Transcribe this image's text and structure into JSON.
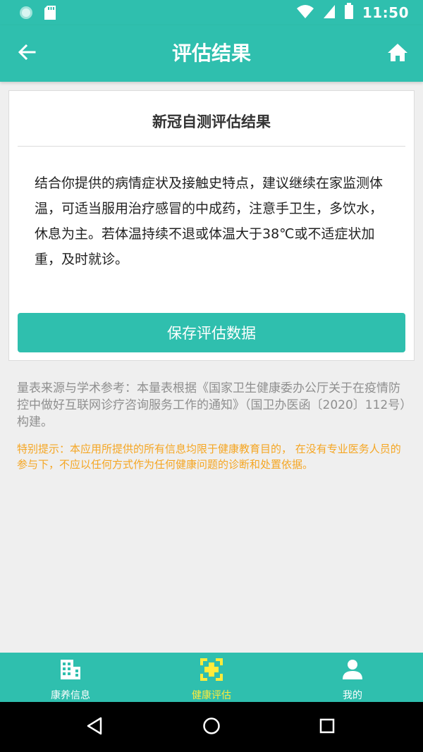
{
  "status_bar": {
    "time": "11:50"
  },
  "app_bar": {
    "title": "评估结果"
  },
  "card": {
    "title": "新冠自测评估结果",
    "body": "结合你提供的病情症状及接触史特点，建议继续在家监测体温，可适当服用治疗感冒的中成药，注意手卫生，多饮水，休息为主。若体温持续不退或体温大于38℃或不适症状加重，及时就诊。",
    "save_label": "保存评估数据"
  },
  "notes": {
    "source": "量表来源与学术参考：本量表根据《国家卫生健康委办公厅关于在疫情防控中做好互联网诊疗咨询服务工作的通知》（国卫办医函〔2020〕112号）构建。",
    "warning": "特别提示：本应用所提供的所有信息均限于健康教育目的， 在没有专业医务人员的参与下，不应以任何方式作为任何健康问题的诊断和处置依据。"
  },
  "bottom_nav": {
    "items": [
      {
        "label": "康养信息",
        "icon": "building-icon",
        "active": false
      },
      {
        "label": "健康评估",
        "icon": "medical-cross-icon",
        "active": true
      },
      {
        "label": "我的",
        "icon": "person-icon",
        "active": false
      }
    ]
  },
  "colors": {
    "primary": "#2fbfae",
    "active_nav": "#ffeb3b",
    "warning_text": "#f5a623",
    "muted_text": "#8f8f8f"
  },
  "icons": {
    "status_left": [
      "app-notification-icon",
      "sd-card-icon"
    ],
    "status_right": [
      "wifi-icon",
      "signal-icon",
      "battery-icon"
    ],
    "app_bar": [
      "back-arrow-icon",
      "home-icon"
    ],
    "system_nav": [
      "back-triangle-icon",
      "home-circle-icon",
      "recents-square-icon"
    ]
  }
}
